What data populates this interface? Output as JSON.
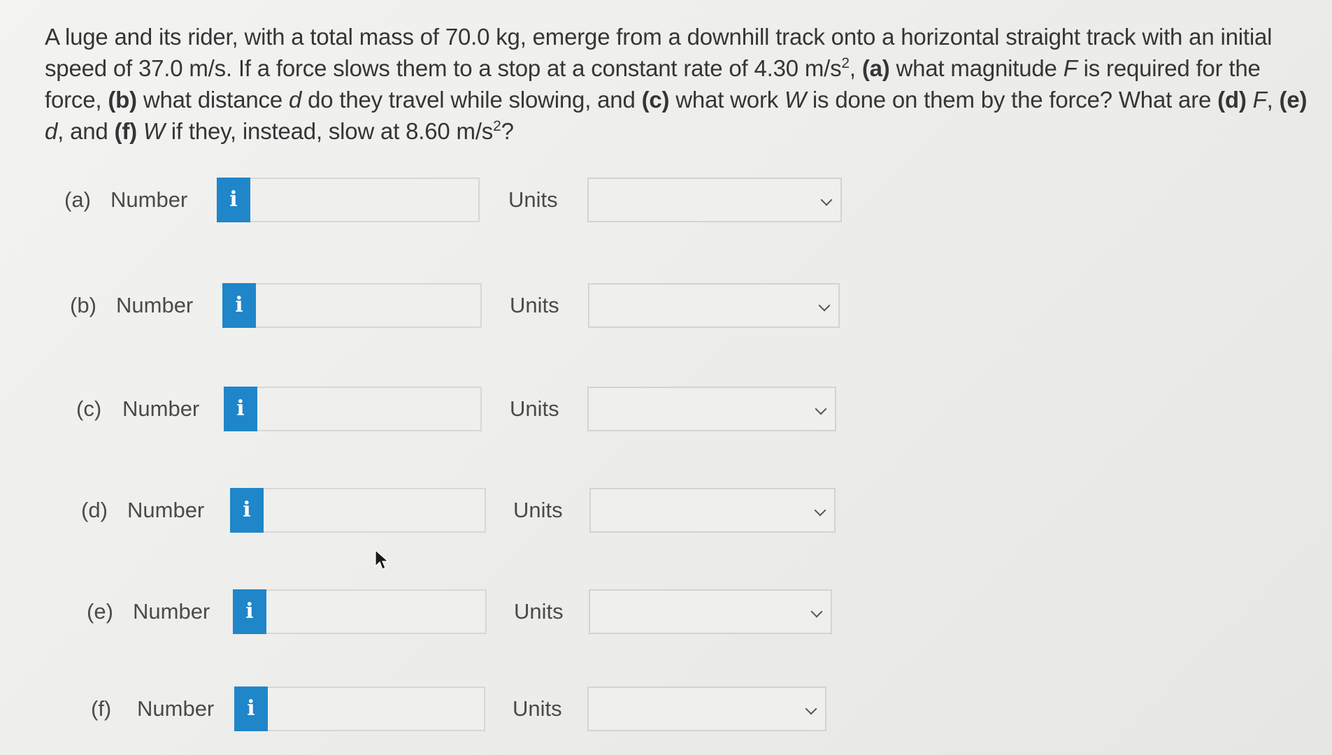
{
  "question": {
    "p1": "A luge and its rider, with a total mass of 70.0 kg, emerge from a downhill track onto a horizontal straight track with an initial speed of 37.0 m/s. If a force slows them to a stop at a constant rate of 4.30 m/s",
    "sup1": "2",
    "p2": ", ",
    "a_tag": "(a)",
    "p3": " what magnitude ",
    "F1": "F",
    "p4": " is required for the force, ",
    "b_tag": "(b)",
    "p5": " what distance ",
    "d1": "d",
    "p6": " do they travel while slowing, and ",
    "c_tag": "(c)",
    "p7": " what work ",
    "W1": "W",
    "p8": " is done on them by the force? What are ",
    "d_tag": "(d)",
    "p9": " ",
    "F2": "F",
    "p10": ", ",
    "e_tag": "(e)",
    "p11": " ",
    "d2": "d",
    "p12": ", and ",
    "f_tag": "(f)",
    "p13": " ",
    "W2": "W",
    "p14": " if they, instead, slow at 8.60 m/s",
    "sup2": "2",
    "p15": "?"
  },
  "parts": [
    {
      "letter": "(a)",
      "label": "Number",
      "info_icon": "i",
      "value": "",
      "units_label": "Units",
      "units_value": ""
    },
    {
      "letter": "(b)",
      "label": "Number",
      "info_icon": "i",
      "value": "",
      "units_label": "Units",
      "units_value": ""
    },
    {
      "letter": "(c)",
      "label": "Number",
      "info_icon": "i",
      "value": "",
      "units_label": "Units",
      "units_value": ""
    },
    {
      "letter": "(d)",
      "label": "Number",
      "info_icon": "i",
      "value": "",
      "units_label": "Units",
      "units_value": ""
    },
    {
      "letter": "(e)",
      "label": "Number",
      "info_icon": "i",
      "value": "",
      "units_label": "Units",
      "units_value": ""
    },
    {
      "letter": "(f)",
      "label": "Number",
      "info_icon": "i",
      "value": "",
      "units_label": "Units",
      "units_value": ""
    }
  ],
  "colors": {
    "info_button": "#1f86c9",
    "background": "#ededeb"
  }
}
